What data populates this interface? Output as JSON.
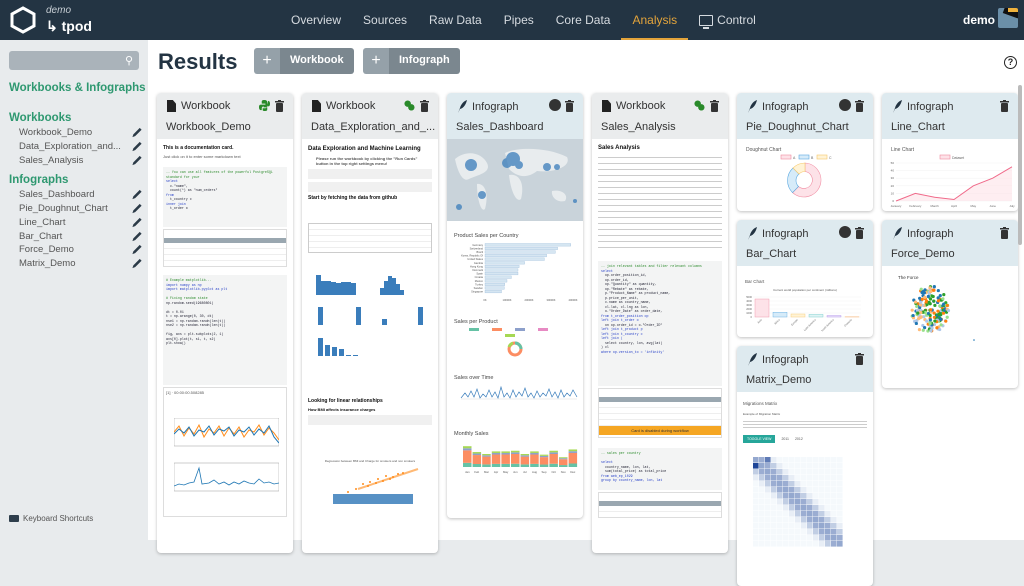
{
  "header": {
    "org": "demo",
    "project": "↳ tpod",
    "nav": [
      {
        "label": "Overview",
        "active": false
      },
      {
        "label": "Sources",
        "active": false
      },
      {
        "label": "Raw Data",
        "active": false
      },
      {
        "label": "Pipes",
        "active": false
      },
      {
        "label": "Core Data",
        "active": false
      },
      {
        "label": "Analysis",
        "active": true
      },
      {
        "label": "Control",
        "active": false,
        "icon": "monitor-icon"
      }
    ],
    "user": "demo",
    "accent_color": "#e3a43b"
  },
  "sidebar": {
    "search_placeholder": "",
    "title": "Workbooks & Infographs",
    "workbooks_title": "Workbooks",
    "workbooks": [
      "Workbook_Demo",
      "Data_Exploration_and...",
      "Sales_Analysis"
    ],
    "infographs_title": "Infographs",
    "infographs": [
      "Sales_Dashboard",
      "Pie_Doughnut_Chart",
      "Line_Chart",
      "Bar_Chart",
      "Force_Demo",
      "Matrix_Demo"
    ],
    "keyboard_shortcuts": "Keyboard Shortcuts",
    "section_color": "#2e9870"
  },
  "main": {
    "title": "Results",
    "add_workbook": "Workbook",
    "add_infograph": "Infograph",
    "plus": "+",
    "help": "?",
    "cards": [
      {
        "type": "Workbook",
        "name": "Workbook_Demo",
        "python": true,
        "published": false,
        "preview": {
          "heading": "This is a documentation card.",
          "text": "Just click on it to enter some markdown text",
          "code_comment": "-- You can use all features of the powerful PostgreSQL standard for your",
          "plot_header": "[1] · 00:00:00.508285"
        }
      },
      {
        "type": "Workbook",
        "name": "Data_Exploration_and_...",
        "python": true,
        "published": false,
        "preview": {
          "heading": "Data Exploration and Machine Learning",
          "note": "Please run the workbook by clicking the \"Run Cards\" button in the top right settings menu!",
          "subheading": "Start by fetching the data from github",
          "section2": "Looking for linear relationships",
          "section2_sub": "How BMI affects insurance charges",
          "scatter_title": "Regression between BMI and Charge for smokers and non smokers"
        }
      },
      {
        "type": "Infograph",
        "name": "Sales_Dashboard",
        "published": true,
        "preview": {
          "chart1": "Product Sales per Country",
          "chart2": "Sales per Product",
          "chart3": "Sales over Time",
          "chart4": "Monthly Sales",
          "countries": [
            "Germany",
            "Switzerland",
            "Brazil",
            "Korea, Republic Of",
            "United States",
            "Gambia",
            "Hong Kong",
            "Denmark",
            "Spain",
            "Croatia",
            "Mexico",
            "Turkey",
            "Sweden",
            "Singapore"
          ],
          "country_values": [
            390000,
            330000,
            320000,
            280000,
            270000,
            180000,
            155000,
            150000,
            150000,
            120000,
            100000,
            90000,
            88000,
            75000
          ],
          "country_axis": [
            "0K",
            "10000K",
            "20000K",
            "30000K",
            "40000K"
          ],
          "products": [
            "ProdA",
            "ProdB",
            "ProdC",
            "ProdD",
            "ProdE"
          ],
          "months": [
            "Jan",
            "Feb",
            "Mar",
            "Apr",
            "May",
            "Jun",
            "Jul",
            "Aug",
            "Sep",
            "Oct",
            "Nov",
            "Dec"
          ],
          "monthly_totals": [
            16000,
            11500,
            10000,
            12000,
            12000,
            12500,
            10000,
            12000,
            9500,
            12500,
            7500,
            13500
          ]
        }
      },
      {
        "type": "Workbook",
        "name": "Sales_Analysis",
        "python": true,
        "published": false,
        "preview": {
          "heading": "Sales Analysis",
          "code_comment": "-- join relevant tables and filter relevant columns",
          "disabled_msg": "Card is disabled during workflow",
          "code_comment2": "-- sales per country"
        }
      },
      {
        "type": "Infograph",
        "name": "Pie_Doughnut_Chart",
        "published": true,
        "preview": {
          "title": "Doughnut Chart",
          "legend": [
            "A",
            "B",
            "C"
          ],
          "values": [
            60,
            25,
            15
          ]
        }
      },
      {
        "type": "Infograph",
        "name": "Line_Chart",
        "published": false,
        "preview": {
          "title": "Line Chart",
          "legend": "Dataset",
          "labels": [
            "January",
            "February",
            "March",
            "April",
            "May",
            "June",
            "July"
          ],
          "values": [
            0,
            10,
            5,
            2,
            20,
            30,
            45
          ],
          "yticks": [
            0,
            10,
            20,
            30,
            40,
            50
          ]
        }
      },
      {
        "type": "Infograph",
        "name": "Bar_Chart",
        "published": true,
        "preview": {
          "title": "Bar Chart",
          "chart_title": "Current world population per continent (millions)",
          "labels": [
            "Asia",
            "Africa",
            "Europe",
            "Latin America",
            "North America",
            "Oceania"
          ],
          "values": [
            4500,
            1200,
            750,
            650,
            360,
            40
          ]
        }
      },
      {
        "type": "Infograph",
        "name": "Force_Demo",
        "published": false,
        "preview": {
          "title": "The Force"
        }
      },
      {
        "type": "Infograph",
        "name": "Matrix_Demo",
        "published": false,
        "preview": {
          "title": "Migrations Matrix",
          "subtitle": "Example of Migration Matrix",
          "toggle": "TOGGLE VIEW",
          "years": [
            "2011",
            "2012"
          ]
        }
      }
    ]
  }
}
